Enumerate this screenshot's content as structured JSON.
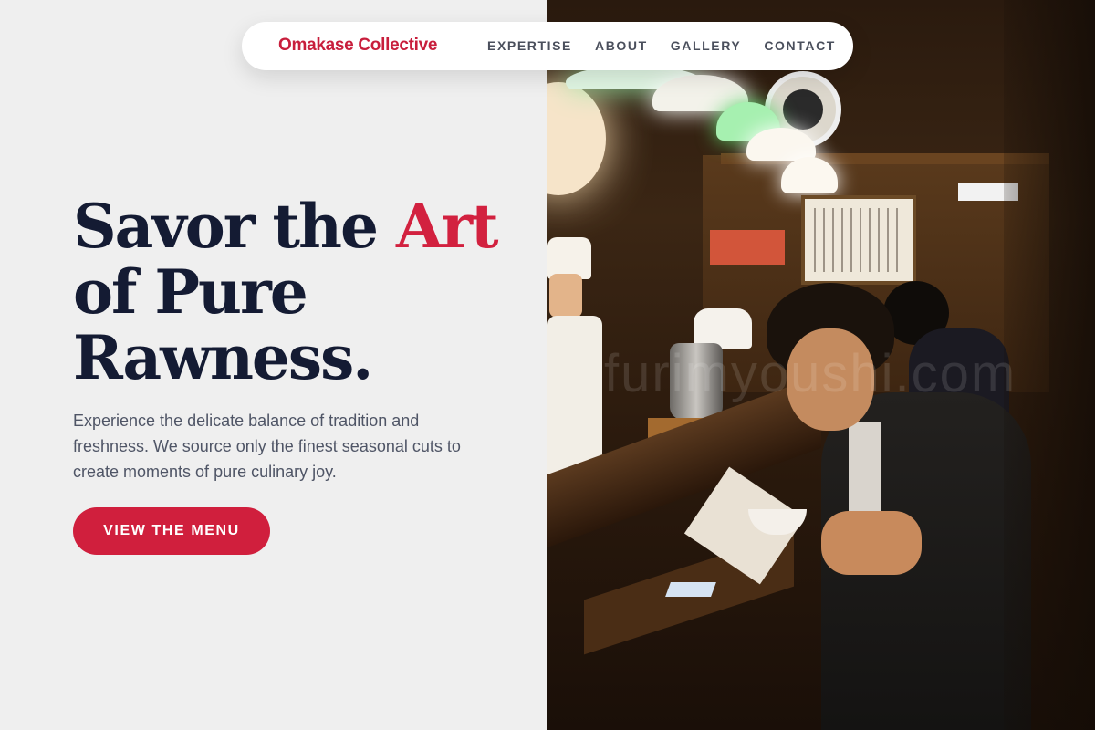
{
  "brand": {
    "name": "Omakase Collective",
    "color": "#c81e3c"
  },
  "nav": {
    "links": [
      {
        "label": "EXPERTISE"
      },
      {
        "label": "ABOUT"
      },
      {
        "label": "GALLERY"
      },
      {
        "label": "CONTACT"
      }
    ]
  },
  "hero": {
    "headline_line1_prefix": "Savor the ",
    "headline_line1_accent": "Art",
    "headline_line2": "of Pure",
    "headline_line3": "Rawness.",
    "subtitle": "Experience the delicate balance of tradition and freshness. We source only the finest seasonal cuts to create moments of pure culinary joy.",
    "cta_label": "VIEW THE MENU",
    "accent_color": "#d2213f",
    "heading_color": "#141b33"
  },
  "image": {
    "description_icon": "restaurant-photo",
    "watermark": "furimyoushi.com"
  }
}
